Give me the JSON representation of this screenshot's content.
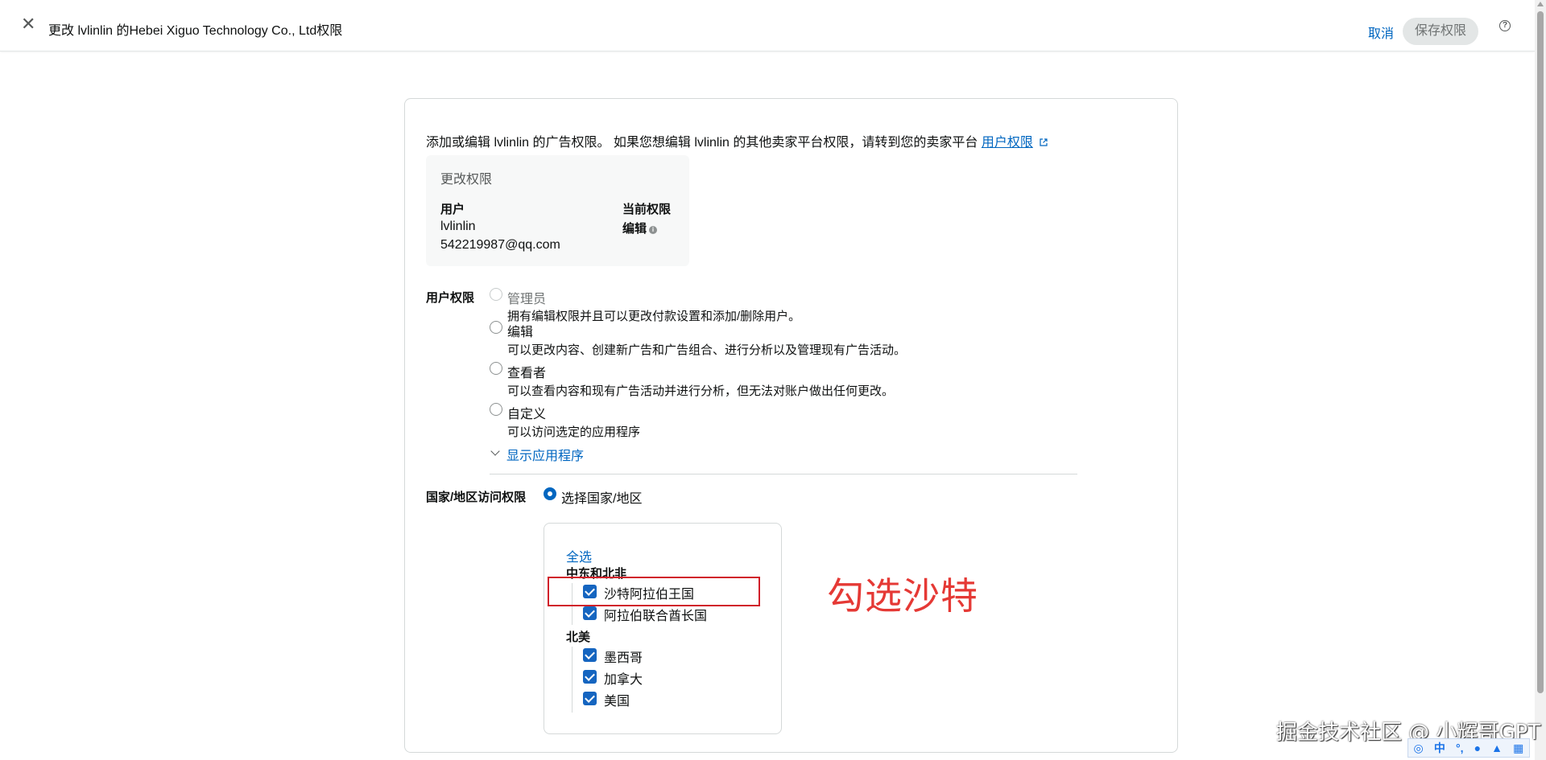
{
  "header": {
    "title": "更改 lvlinlin 的Hebei Xiguo Technology Co., Ltd权限",
    "cancel_label": "取消",
    "save_label": "保存权限",
    "help": "?"
  },
  "intro": {
    "text": "添加或编辑 lvlinlin 的广告权限。 如果您想编辑 lvlinlin 的其他卖家平台权限，请转到您的卖家平台",
    "link_label": "用户权限"
  },
  "perm_box": {
    "header": "更改权限",
    "user_label": "用户",
    "current_label": "当前权限",
    "username": "lvlinlin",
    "email": "542219987@qq.com",
    "current_value": "编辑"
  },
  "user_permissions": {
    "label": "用户权限",
    "options": [
      {
        "title": "管理员",
        "desc": "拥有编辑权限并且可以更改付款设置和添加/删除用户。"
      },
      {
        "title": "编辑",
        "desc": "可以更改内容、创建新广告和广告组合、进行分析以及管理现有广告活动。"
      },
      {
        "title": "查看者",
        "desc": "可以查看内容和现有广告活动并进行分析，但无法对账户做出任何更改。"
      },
      {
        "title": "自定义",
        "desc": "可以访问选定的应用程序"
      }
    ],
    "show_apps": "显示应用程序"
  },
  "country_access": {
    "label": "国家/地区访问权限",
    "option": "选择国家/地区",
    "select_all": "全选",
    "regions": [
      {
        "name": "中东和北非",
        "countries": [
          "沙特阿拉伯王国",
          "阿拉伯联合酋长国"
        ]
      },
      {
        "name": "北美",
        "countries": [
          "墨西哥",
          "加拿大",
          "美国"
        ]
      }
    ]
  },
  "annotation": "勾选沙特",
  "watermark": "掘金技术社区 @ 小辉哥GPT",
  "ime": {
    "lang": "中"
  },
  "colors": {
    "link": "#0066c0",
    "checkbox": "#1565c0",
    "annotation": "#e53935"
  }
}
